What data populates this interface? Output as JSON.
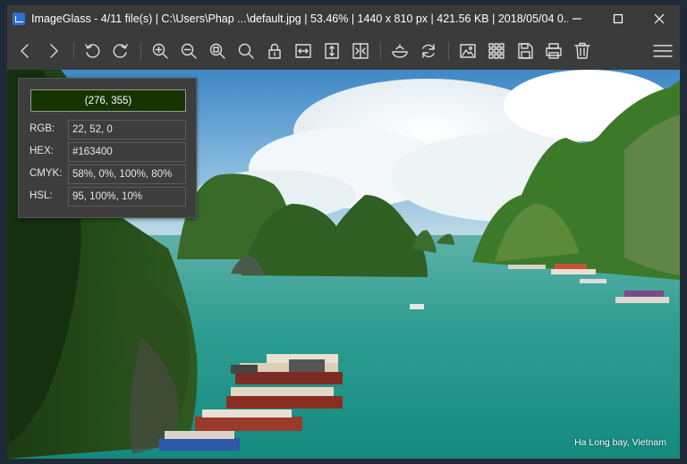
{
  "window": {
    "title": "ImageGlass - 4/11 file(s)  |  C:\\Users\\Phap ...\\default.jpg  |  53.46%  |  1440 x 810 px  |  421.56 KB  |  2018/05/04 0..."
  },
  "toolbar": {
    "icons": [
      "arrow-left-icon",
      "arrow-right-icon",
      "rotate-left-icon",
      "rotate-right-icon",
      "zoom-in-icon",
      "zoom-out-icon",
      "zoom-to-fit-icon",
      "actual-size-icon",
      "lock-zoom-icon",
      "scale-width-icon",
      "scale-height-icon",
      "auto-zoom-icon",
      "open-with-icon",
      "refresh-icon",
      "gallery-icon",
      "thumbnail-icon",
      "save-icon",
      "print-icon",
      "delete-icon",
      "menu-icon"
    ]
  },
  "color_picker": {
    "coordinates": "(276, 355)",
    "swatch_color": "#163400",
    "rows": [
      {
        "label": "RGB:",
        "value": "22, 52, 0"
      },
      {
        "label": "HEX:",
        "value": "#163400"
      },
      {
        "label": "CMYK:",
        "value": "58%, 0%, 100%, 80%"
      },
      {
        "label": "HSL:",
        "value": "95, 100%, 10%"
      }
    ]
  },
  "image": {
    "caption": "Ha Long bay, Vietnam"
  }
}
